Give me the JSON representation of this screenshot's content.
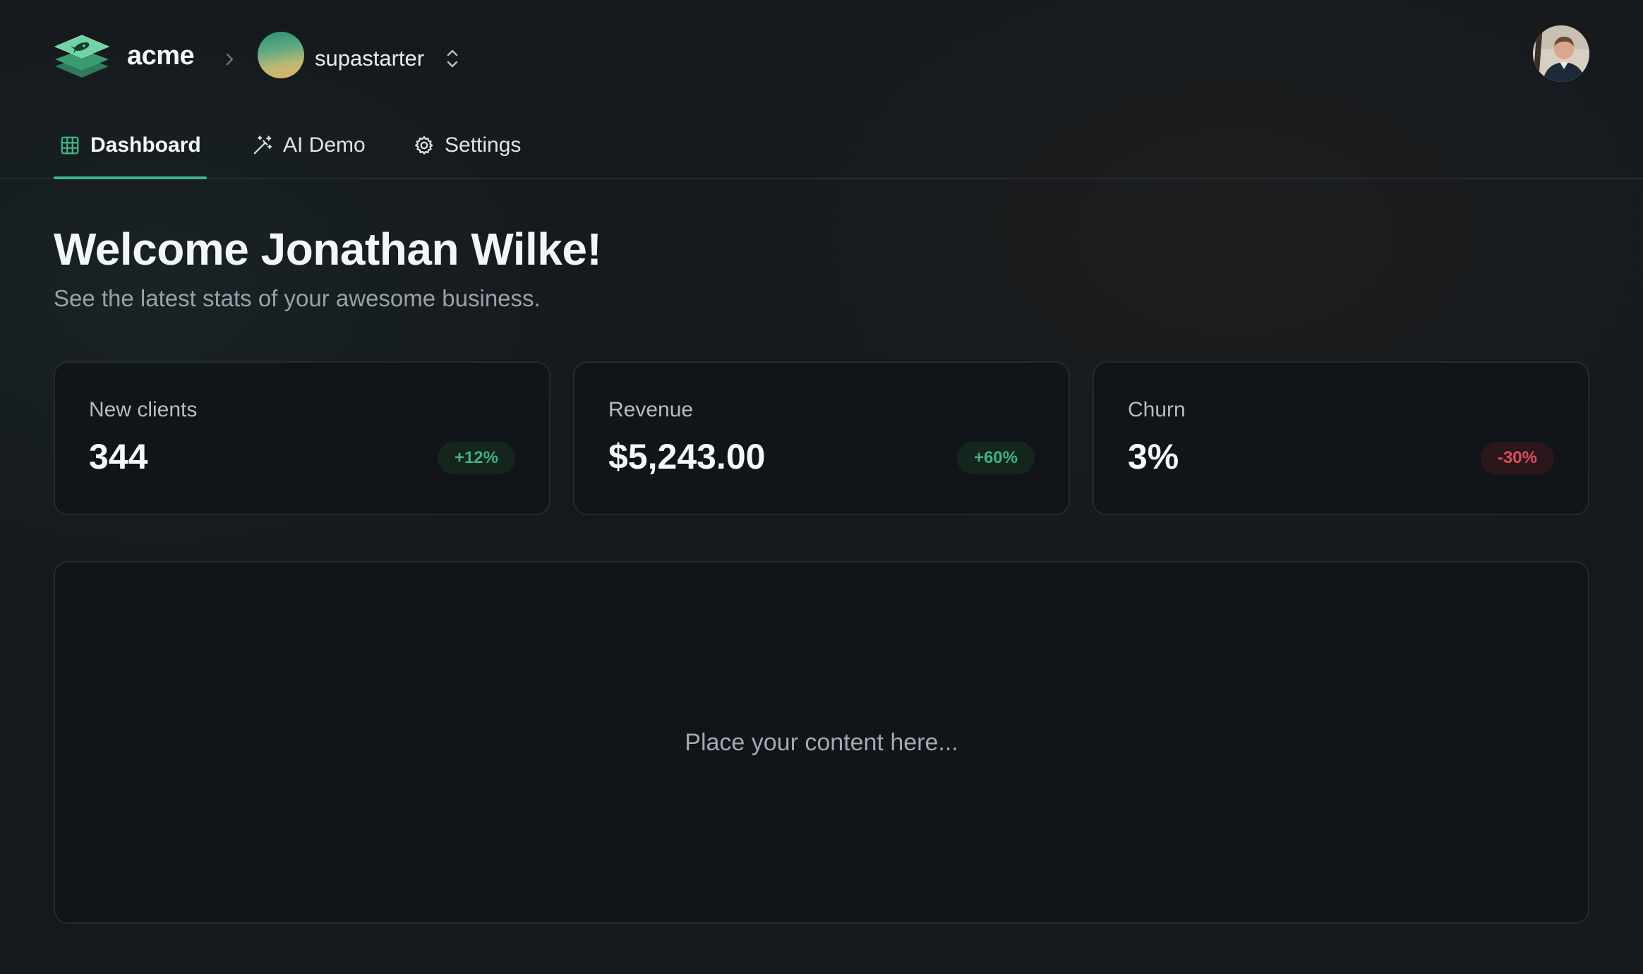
{
  "header": {
    "brand": "acme",
    "organization": "supastarter",
    "icons": {
      "logo": "stacked-layers-rocket-logo",
      "separator": "chevron-right-icon",
      "switcher": "chevrons-up-down-icon",
      "user": "user-avatar"
    }
  },
  "tabs": [
    {
      "label": "Dashboard",
      "icon": "layout-grid-icon",
      "active": true
    },
    {
      "label": "AI Demo",
      "icon": "wand-sparkles-icon",
      "active": false
    },
    {
      "label": "Settings",
      "icon": "gear-icon",
      "active": false
    }
  ],
  "welcome": {
    "title": "Welcome Jonathan Wilke!",
    "subtitle": "See the latest stats of your awesome business."
  },
  "stats": [
    {
      "label": "New clients",
      "value": "344",
      "trend": "+12%",
      "direction": "up"
    },
    {
      "label": "Revenue",
      "value": "$5,243.00",
      "trend": "+60%",
      "direction": "up"
    },
    {
      "label": "Churn",
      "value": "3%",
      "trend": "-30%",
      "direction": "down"
    }
  ],
  "content": {
    "placeholder": "Place your content here..."
  },
  "colors": {
    "background": "#15191d",
    "card": "#111418",
    "accent": "#3fb68a",
    "positive": "#3fb17f",
    "negative": "#e24a5f"
  }
}
